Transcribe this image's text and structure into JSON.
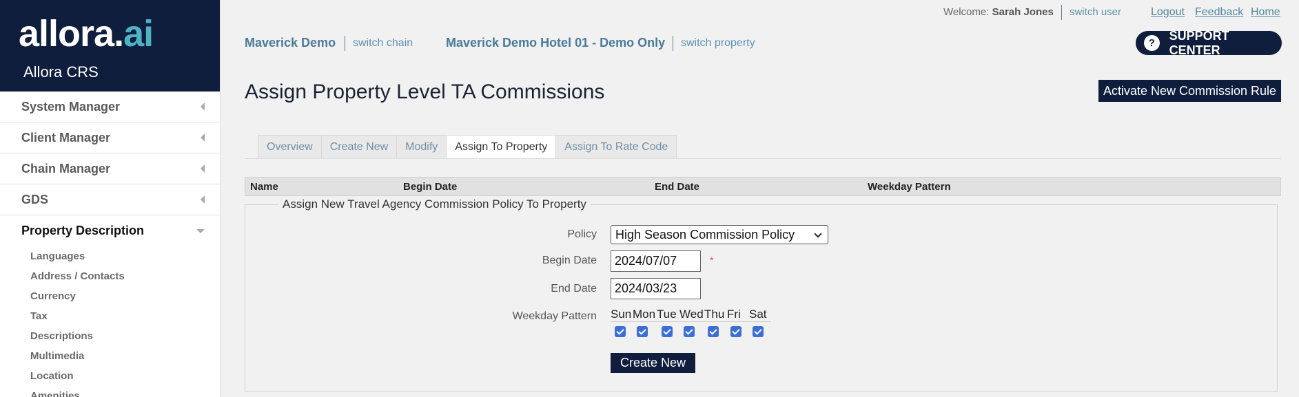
{
  "brand": {
    "logo_main": "allora.",
    "logo_accent": "ai",
    "subtitle": "Allora CRS"
  },
  "sidebar": {
    "items": [
      {
        "label": "System Manager"
      },
      {
        "label": "Client Manager"
      },
      {
        "label": "Chain Manager"
      },
      {
        "label": "GDS"
      },
      {
        "label": "Property Description"
      }
    ],
    "subitems": [
      "Languages",
      "Address / Contacts",
      "Currency",
      "Tax",
      "Descriptions",
      "Multimedia",
      "Location",
      "Amenities"
    ]
  },
  "topbar": {
    "welcome_prefix": "Welcome:",
    "user_name": "Sarah Jones",
    "switch_user": "switch user",
    "logout": "Logout",
    "feedback": "Feedback",
    "home": "Home"
  },
  "chain": {
    "chain_name": "Maverick Demo",
    "switch_chain": "switch chain",
    "property_name": "Maverick Demo Hotel 01 - Demo Only",
    "switch_property": "switch property"
  },
  "support": {
    "icon": "?",
    "label": "SUPPORT CENTER"
  },
  "page": {
    "title": "Assign Property Level TA Commissions",
    "activate_button": "Activate New Commission Rule"
  },
  "tabs": [
    "Overview",
    "Create New",
    "Modify",
    "Assign To Property",
    "Assign To Rate Code"
  ],
  "table": {
    "headers": [
      "Name",
      "Begin Date",
      "End Date",
      "Weekday Pattern"
    ]
  },
  "form": {
    "legend": "Assign New Travel Agency Commission Policy To Property",
    "policy_label": "Policy",
    "policy_value": "High Season Commission Policy",
    "begin_label": "Begin Date",
    "begin_value": "2024/07/07",
    "required_mark": "*",
    "end_label": "End Date",
    "end_value": "2024/03/23",
    "weekday_label": "Weekday Pattern",
    "days": [
      "Sun",
      "Mon",
      "Tue",
      "Wed",
      "Thu",
      "Fri",
      "Sat"
    ],
    "create_button": "Create New"
  },
  "colors": {
    "navy": "#0f1e3d",
    "accent": "#4fb3c6",
    "link": "#4f85a6"
  }
}
